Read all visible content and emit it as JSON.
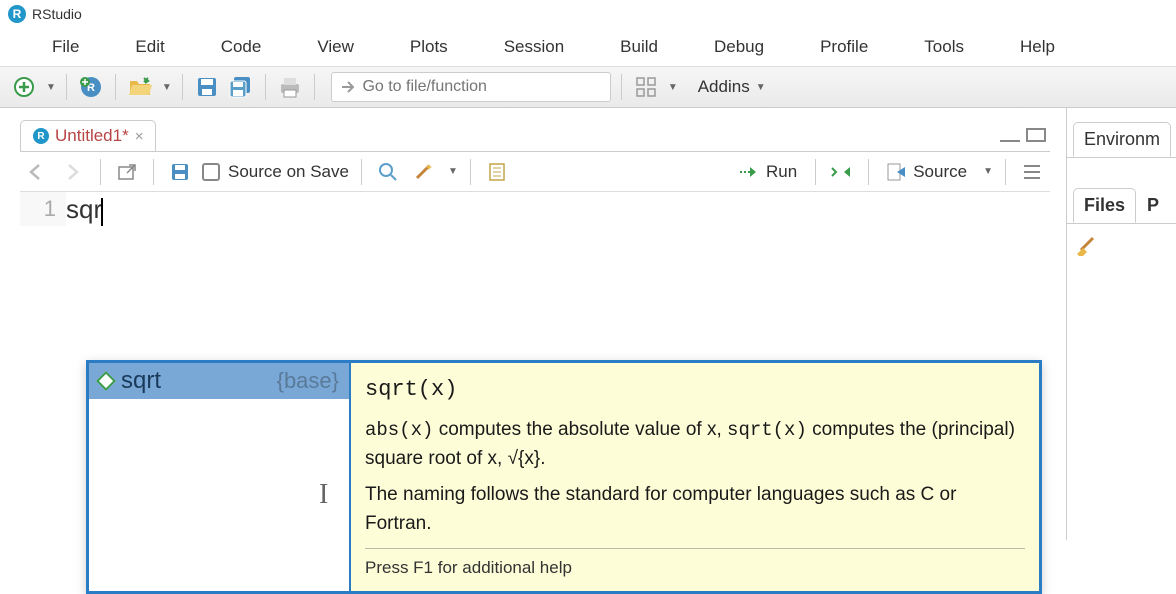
{
  "app": {
    "title": "RStudio"
  },
  "menu": [
    "File",
    "Edit",
    "Code",
    "View",
    "Plots",
    "Session",
    "Build",
    "Debug",
    "Profile",
    "Tools",
    "Help"
  ],
  "toolbar": {
    "search_placeholder": "Go to file/function",
    "addins_label": "Addins"
  },
  "editor": {
    "tabs": [
      {
        "name": "Untitled1*",
        "dirty": true
      }
    ],
    "source_on_save_label": "Source on Save",
    "run_label": "Run",
    "source_label": "Source",
    "line_number": "1",
    "typed": "sqr"
  },
  "autocomplete": {
    "items": [
      {
        "name": "sqrt",
        "package": "{base}",
        "selected": true
      }
    ],
    "signature": "sqrt(x)",
    "desc_pre": "abs(x)",
    "desc_mid": " computes the absolute value of x, ",
    "desc_code2": "sqrt(x)",
    "desc_post": " computes the (principal) square root of x, √{x}.",
    "desc_line2": "The naming follows the standard for computer languages such as C or Fortran.",
    "footer": "Press F1 for additional help"
  },
  "right": {
    "env_tab": "Environm",
    "files_tab": "Files",
    "p_tab": "P"
  }
}
